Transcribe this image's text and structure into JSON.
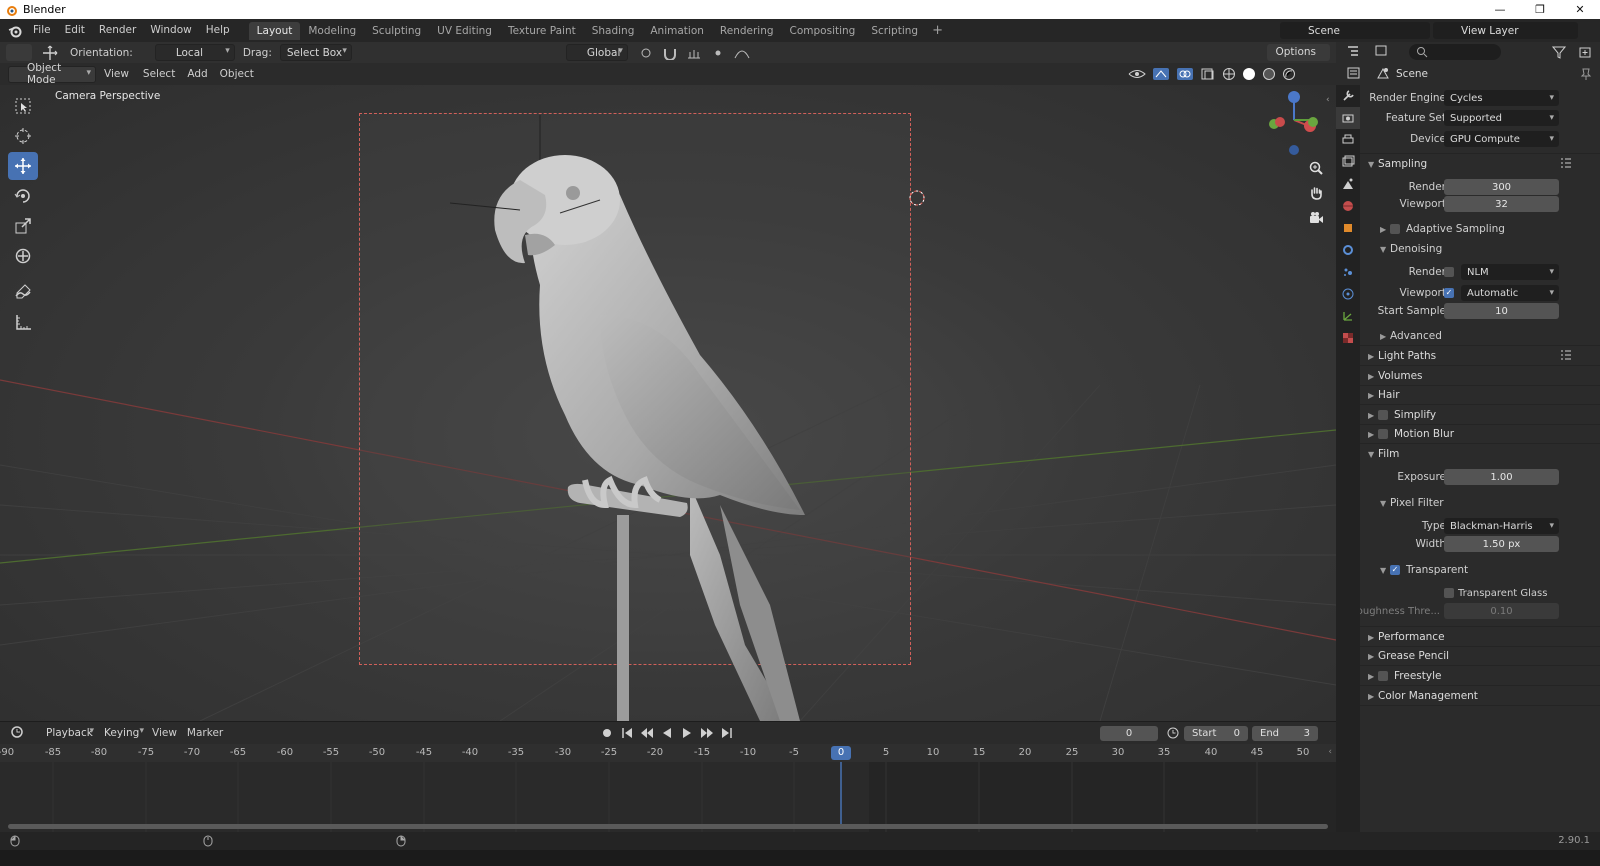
{
  "window": {
    "title": "Blender"
  },
  "menu": [
    "File",
    "Edit",
    "Render",
    "Window",
    "Help"
  ],
  "workspaces": [
    {
      "label": "Layout",
      "active": true
    },
    {
      "label": "Modeling"
    },
    {
      "label": "Sculpting"
    },
    {
      "label": "UV Editing"
    },
    {
      "label": "Texture Paint"
    },
    {
      "label": "Shading"
    },
    {
      "label": "Animation"
    },
    {
      "label": "Rendering"
    },
    {
      "label": "Compositing"
    },
    {
      "label": "Scripting"
    }
  ],
  "scene_selector": "Scene",
  "view_layer_selector": "View Layer",
  "toolbar": {
    "orientation_label": "Orientation:",
    "orientation_value": "Local",
    "drag_label": "Drag:",
    "drag_value": "Select Box",
    "transform_orientation": "Global",
    "options_label": "Options"
  },
  "viewport_header": {
    "mode": "Object Mode",
    "menus": [
      "View",
      "Select",
      "Add",
      "Object"
    ]
  },
  "viewport": {
    "label": "Camera Perspective"
  },
  "timeline": {
    "menus": [
      "Playback",
      "Keying",
      "View",
      "Marker"
    ],
    "current_frame": "0",
    "start_label": "Start",
    "start_value": "0",
    "end_label": "End",
    "end_value": "3",
    "ticks": [
      "-90",
      "-85",
      "-80",
      "-75",
      "-70",
      "-65",
      "-60",
      "-55",
      "-50",
      "-45",
      "-40",
      "-35",
      "-30",
      "-25",
      "-20",
      "-15",
      "-10",
      "-5",
      "0",
      "5",
      "10",
      "15",
      "20",
      "25",
      "30",
      "35",
      "40",
      "45",
      "50"
    ],
    "playhead": "0"
  },
  "status": {
    "version": "2.90.1"
  },
  "properties": {
    "context": "Scene",
    "render_engine_label": "Render Engine",
    "render_engine": "Cycles",
    "feature_set_label": "Feature Set",
    "feature_set": "Supported",
    "device_label": "Device",
    "device": "GPU Compute",
    "sampling": "Sampling",
    "render_label": "Render",
    "render_samples": "300",
    "viewport_label": "Viewport",
    "viewport_samples": "32",
    "adaptive_sampling": "Adaptive Sampling",
    "denoising": "Denoising",
    "denoise_render_label": "Render",
    "denoise_render": "NLM",
    "denoise_viewport_label": "Viewport",
    "denoise_viewport": "Automatic",
    "start_sample_label": "Start Sample",
    "start_sample": "10",
    "advanced": "Advanced",
    "light_paths": "Light Paths",
    "volumes": "Volumes",
    "hair": "Hair",
    "simplify": "Simplify",
    "motion_blur": "Motion Blur",
    "film": "Film",
    "exposure_label": "Exposure",
    "exposure": "1.00",
    "pixel_filter": "Pixel Filter",
    "type_label": "Type",
    "type": "Blackman-Harris",
    "width_label": "Width",
    "width": "1.50 px",
    "transparent": "Transparent",
    "transparent_glass": "Transparent Glass",
    "roughness_label": "Roughness Thre...",
    "roughness": "0.10",
    "performance": "Performance",
    "grease_pencil": "Grease Pencil",
    "freestyle": "Freestyle",
    "color_management": "Color Management"
  }
}
